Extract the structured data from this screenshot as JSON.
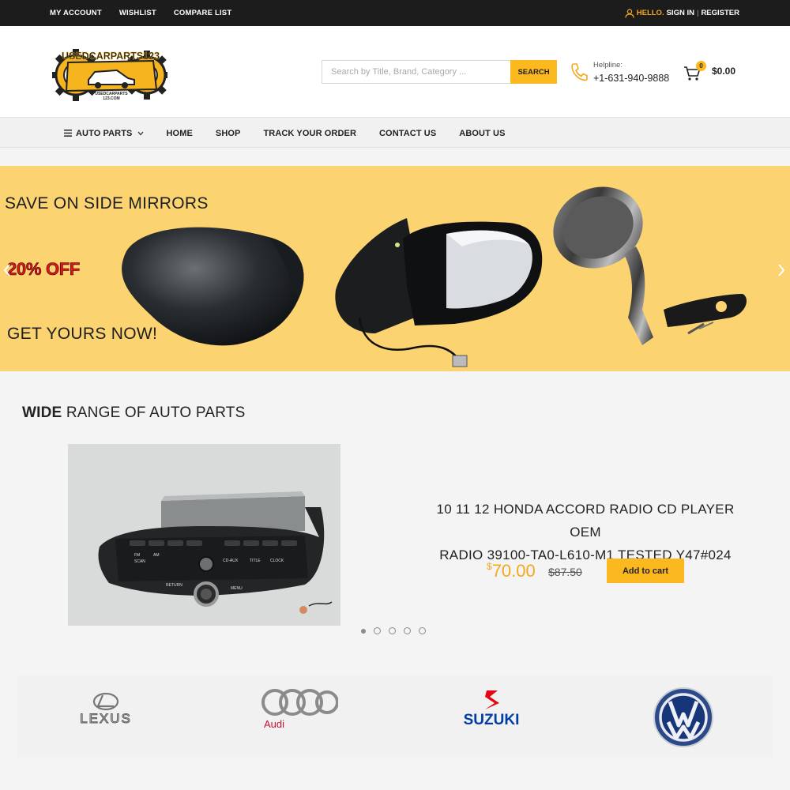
{
  "topbar": {
    "links": [
      "MY ACCOUNT",
      "WISHLIST",
      "COMPARE LIST"
    ],
    "hello": "HELLO.",
    "sign_in": "SIGN IN",
    "separator": "|",
    "register": "REGISTER"
  },
  "header": {
    "logo_text_top": "USEDCARPARTS123",
    "logo_text_bottom_1": "USEDCARPARTS",
    "logo_text_bottom_2": "123.COM",
    "search_placeholder": "Search by Title, Brand, Category ...",
    "search_button": "SEARCH",
    "helpline_label": "Helpline:",
    "helpline_number": "+1-631-940-9888",
    "cart_count": "0",
    "cart_total": "$0.00"
  },
  "nav": {
    "items": [
      "AUTO PARTS",
      "HOME",
      "SHOP",
      "TRACK YOUR ORDER",
      "CONTACT US",
      "ABOUT US"
    ]
  },
  "banner": {
    "headline": "SAVE ON SIDE MIRRORS",
    "discount": "20% OFF",
    "cta": "GET YOURS NOW!",
    "background_color": "#fbd370"
  },
  "section": {
    "title_bold": "WIDE",
    "title_rest": " RANGE OF AUTO PARTS"
  },
  "product": {
    "title_line1": "10 11 12 HONDA ACCORD RADIO CD PLAYER OEM",
    "title_line2": "RADIO 39100-TA0-L610-M1 TESTED Y47#024",
    "currency": "$",
    "price": "70.00",
    "old_price": "$87.50",
    "add_to_cart": "Add to cart",
    "radio_labels": [
      "SCAN",
      "FM",
      "AM",
      "CD-AUX",
      "TITLE",
      "CLOCK",
      "RETURN",
      "MENU"
    ],
    "carousel_pages": 5,
    "carousel_active": 1
  },
  "brands": {
    "lexus": "LEXUS",
    "audi": "Audi",
    "suzuki": "SUZUKI",
    "vw": "VW"
  },
  "colors": {
    "accent": "#fbb81f",
    "topbar": "#1c1c1c",
    "price": "#f5a81e",
    "discount": "#e3141c"
  }
}
